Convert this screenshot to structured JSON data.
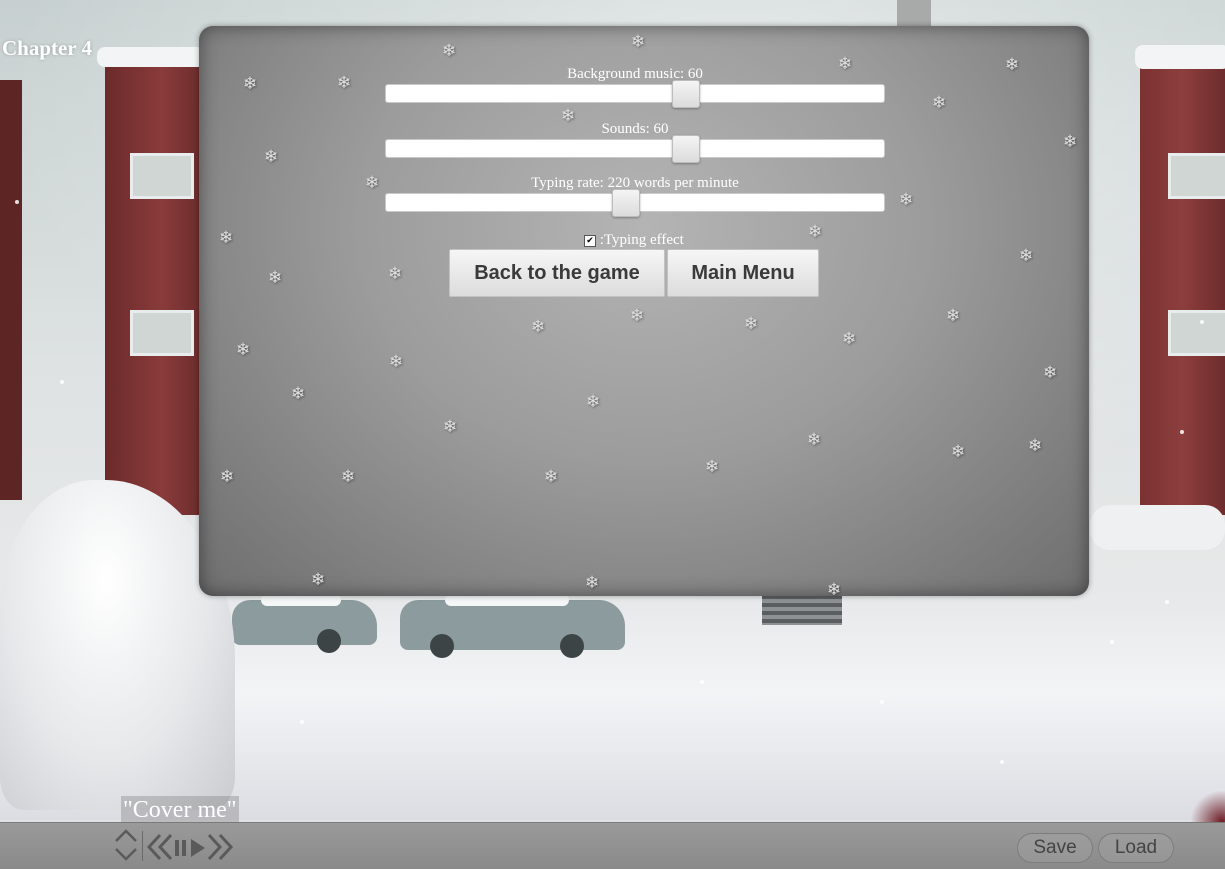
{
  "chapter_title": "Chapter 4",
  "settings": {
    "music": {
      "label": "Background music: 60",
      "value": 60,
      "max": 100
    },
    "sounds": {
      "label": "Sounds: 60",
      "value": 60,
      "max": 100
    },
    "typing_rate": {
      "label": "Typing rate: 220 words per minute",
      "value_fraction": 0.48
    },
    "typing_effect": {
      "label": ":Typing effect",
      "checked": true
    }
  },
  "buttons": {
    "back_to_game": "Back to the game",
    "main_menu": "Main Menu"
  },
  "dialogue": "\"Cover me\"",
  "bottom_bar": {
    "save": "Save",
    "load": "Load",
    "icons": [
      "scroll-up-down-icon",
      "rewind-icon",
      "pause-icon",
      "play-icon",
      "fast-forward-icon"
    ]
  },
  "colors": {
    "panel": "#9c9c9c",
    "button_text": "#3a3a3a",
    "text": "#ffffff"
  }
}
